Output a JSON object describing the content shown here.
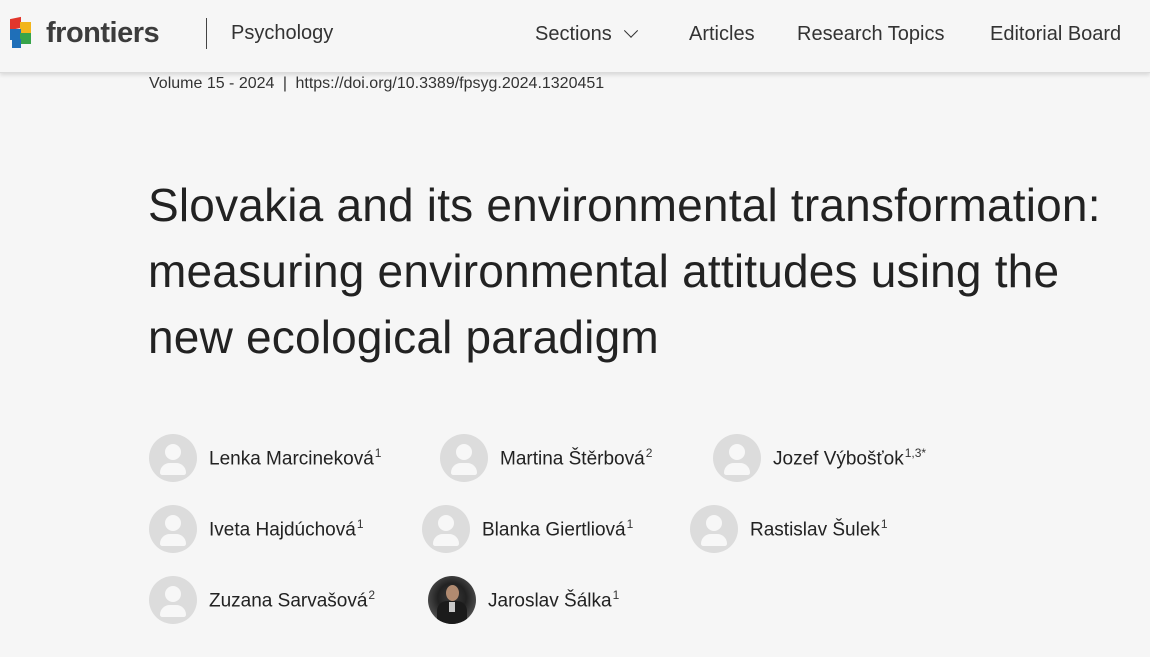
{
  "brand": {
    "name": "frontiers",
    "journal": "Psychology"
  },
  "nav": [
    {
      "label": "Sections",
      "has_dropdown": true
    },
    {
      "label": "Articles"
    },
    {
      "label": "Research Topics"
    },
    {
      "label": "Editorial Board"
    }
  ],
  "article": {
    "volume": "Volume 15 - 2024",
    "separator": "|",
    "doi": "https://doi.org/10.3389/fpsyg.2024.1320451",
    "title": "Slovakia and its environmental transformation: measuring environmental attitudes using the new ecological paradigm"
  },
  "authors": [
    {
      "name": "Lenka Marcineková",
      "aff": "1",
      "avatar": "placeholder"
    },
    {
      "name": "Martina Štěrbová",
      "aff": "2",
      "avatar": "placeholder"
    },
    {
      "name": "Jozef Výbošťok",
      "aff": "1,3*",
      "avatar": "placeholder"
    },
    {
      "name": "Iveta Hajdúchová",
      "aff": "1",
      "avatar": "placeholder"
    },
    {
      "name": "Blanka Giertliová",
      "aff": "1",
      "avatar": "placeholder"
    },
    {
      "name": "Rastislav Šulek",
      "aff": "1",
      "avatar": "placeholder"
    },
    {
      "name": "Zuzana Sarvašová",
      "aff": "2",
      "avatar": "placeholder"
    },
    {
      "name": "Jaroslav Šálka",
      "aff": "1",
      "avatar": "photo"
    }
  ],
  "colors": {
    "background": "#f6f6f6",
    "logo_red": "#e2362c",
    "logo_blue": "#1f6fb8",
    "logo_green": "#37a44a",
    "logo_yellow": "#f2b51b"
  }
}
